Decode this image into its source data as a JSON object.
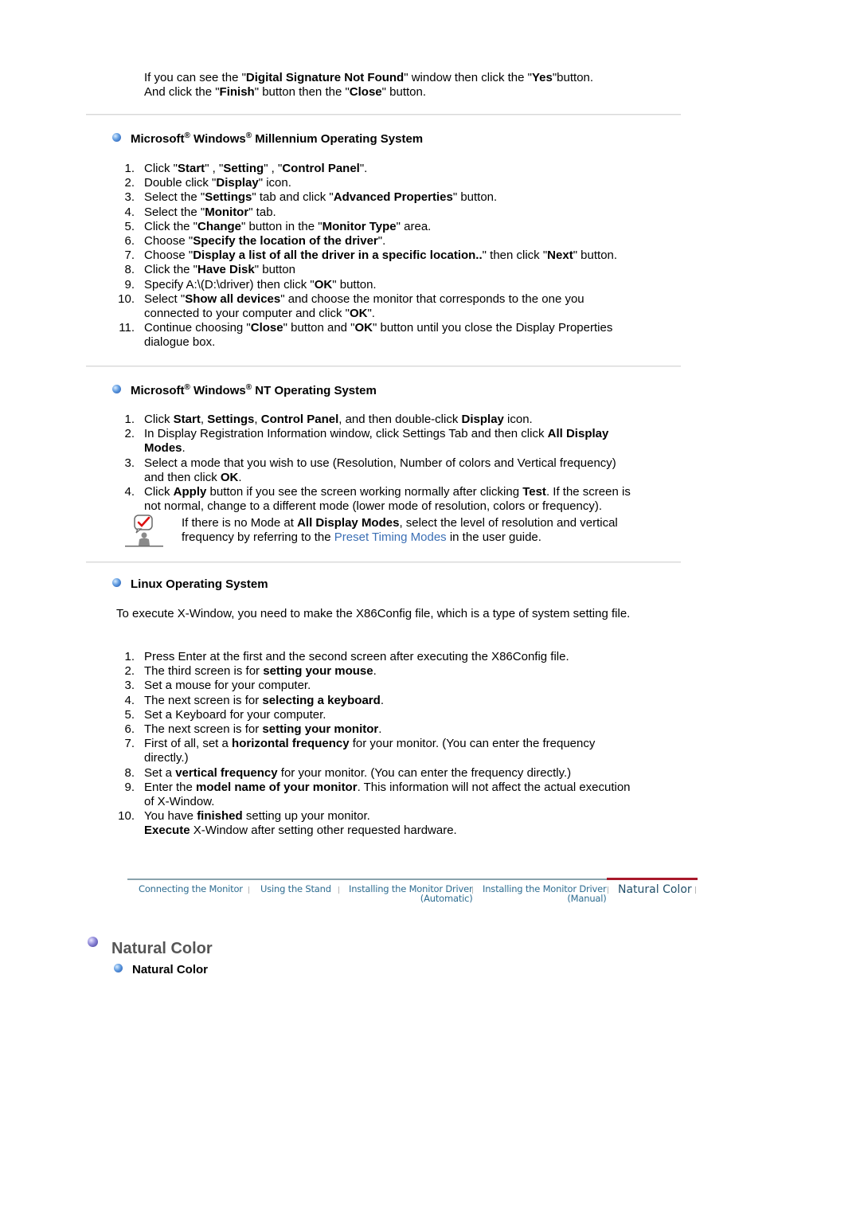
{
  "intro": {
    "line1": [
      "If you can see the \"",
      {
        "b": "Digital Signature Not Found"
      },
      "\" window then click the \"",
      {
        "b": "Yes"
      },
      "\"button."
    ],
    "line2": [
      "And click the \"",
      {
        "b": "Finish"
      },
      "\" button then the \"",
      {
        "b": "Close"
      },
      "\" button."
    ]
  },
  "sections": {
    "millennium": {
      "title_parts": [
        "Microsoft",
        "®",
        " Windows",
        "®",
        " Millennium Operating System"
      ],
      "steps": [
        [
          "Click \"",
          {
            "b": "Start"
          },
          "\" , \"",
          {
            "b": "Setting"
          },
          "\" , \"",
          {
            "b": "Control Panel"
          },
          "\"."
        ],
        [
          "Double click \"",
          {
            "b": "Display"
          },
          "\" icon."
        ],
        [
          "Select the \"",
          {
            "b": "Settings"
          },
          "\" tab and click \"",
          {
            "b": "Advanced Properties"
          },
          "\" button."
        ],
        [
          "Select the \"",
          {
            "b": "Monitor"
          },
          "\" tab."
        ],
        [
          "Click the \"",
          {
            "b": "Change"
          },
          "\" button in the \"",
          {
            "b": "Monitor Type"
          },
          "\" area."
        ],
        [
          "Choose \"",
          {
            "b": "Specify the location of the driver"
          },
          "\"."
        ],
        [
          "Choose \"",
          {
            "b": "Display a list of all the driver in a specific location.."
          },
          "\" then click \"",
          {
            "b": "Next"
          },
          "\" button."
        ],
        [
          "Click the \"",
          {
            "b": "Have Disk"
          },
          "\" button"
        ],
        [
          "Specify A:\\(D:\\driver) then click \"",
          {
            "b": "OK"
          },
          "\" button."
        ],
        [
          "Select \"",
          {
            "b": "Show all devices"
          },
          "\" and choose the monitor that corresponds to the one you",
          {
            "br": true
          },
          "connected to your computer and click \"",
          {
            "b": "OK"
          },
          "\"."
        ],
        [
          "Continue choosing \"",
          {
            "b": "Close"
          },
          "\" button and \"",
          {
            "b": "OK"
          },
          "\" button until you close the Display Properties",
          {
            "br": true
          },
          "dialogue box."
        ]
      ]
    },
    "nt": {
      "title_parts": [
        "Microsoft",
        "®",
        " Windows",
        "®",
        " NT Operating System"
      ],
      "steps": [
        [
          "Click ",
          {
            "b": "Start"
          },
          ", ",
          {
            "b": "Settings"
          },
          ", ",
          {
            "b": "Control Panel"
          },
          ", and then double-click ",
          {
            "b": "Display"
          },
          " icon."
        ],
        [
          "In Display Registration Information window, click Settings Tab and then click ",
          {
            "b": "All Display"
          },
          {
            "br": true
          },
          {
            "b": "Modes"
          },
          "."
        ],
        [
          "Select a mode that you wish to use (Resolution, Number of colors and Vertical frequency)",
          {
            "br": true
          },
          "and then click ",
          {
            "b": "OK"
          },
          "."
        ],
        [
          "Click ",
          {
            "b": "Apply"
          },
          " button if you see the screen working normally after clicking ",
          {
            "b": "Test"
          },
          ". If the screen is",
          {
            "br": true
          },
          "not normal, change to a different mode (lower mode of resolution, colors or frequency)."
        ]
      ],
      "note": {
        "icon": "note-checkmark-person-icon",
        "parts": [
          "If there is no Mode at ",
          {
            "b": "All Display Modes"
          },
          ", select the level of resolution and vertical",
          {
            "br": true
          },
          "frequency by referring to the ",
          {
            "link": "Preset Timing Modes"
          },
          " in the user guide."
        ]
      }
    },
    "linux": {
      "title_parts": [
        "Linux Operating System"
      ],
      "intro": "To execute X-Window, you need to make the X86Config file, which is a type of system setting file.",
      "steps": [
        [
          "Press Enter at the first and the second screen after executing the X86Config file."
        ],
        [
          "The third screen is for ",
          {
            "b": "setting your mouse"
          },
          "."
        ],
        [
          "Set a mouse for your computer."
        ],
        [
          "The next screen is for ",
          {
            "b": "selecting a keyboard"
          },
          "."
        ],
        [
          "Set a Keyboard for your computer."
        ],
        [
          "The next screen is for ",
          {
            "b": "setting your monitor"
          },
          "."
        ],
        [
          "First of all, set a ",
          {
            "b": "horizontal frequency"
          },
          " for your monitor. (You can enter the frequency",
          {
            "br": true
          },
          "directly.)"
        ],
        [
          "Set a ",
          {
            "b": "vertical frequency"
          },
          " for your monitor. (You can enter the frequency directly.)"
        ],
        [
          "Enter the ",
          {
            "b": "model name of your monitor"
          },
          ". This information will not affect the actual execution",
          {
            "br": true
          },
          "of X-Window."
        ],
        [
          "You have ",
          {
            "b": "finished"
          },
          " setting up your monitor.",
          {
            "br": true
          },
          {
            "b": "Execute"
          },
          " X-Window after setting other requested hardware."
        ]
      ]
    }
  },
  "nav": {
    "items": [
      {
        "label": "Connecting  the Monitor"
      },
      {
        "label": "Using the Stand"
      },
      {
        "label": "Installing the Monitor Driver",
        "sub": "(Automatic)"
      },
      {
        "label": "Installing the Monitor Driver",
        "sub": "(Manual)"
      }
    ],
    "active": "Natural Color",
    "colors": {
      "link": "#2d6c90",
      "active_bar": "#a8182a"
    }
  },
  "natural_color": {
    "title": "Natural Color",
    "subtitle": "Natural Color"
  }
}
